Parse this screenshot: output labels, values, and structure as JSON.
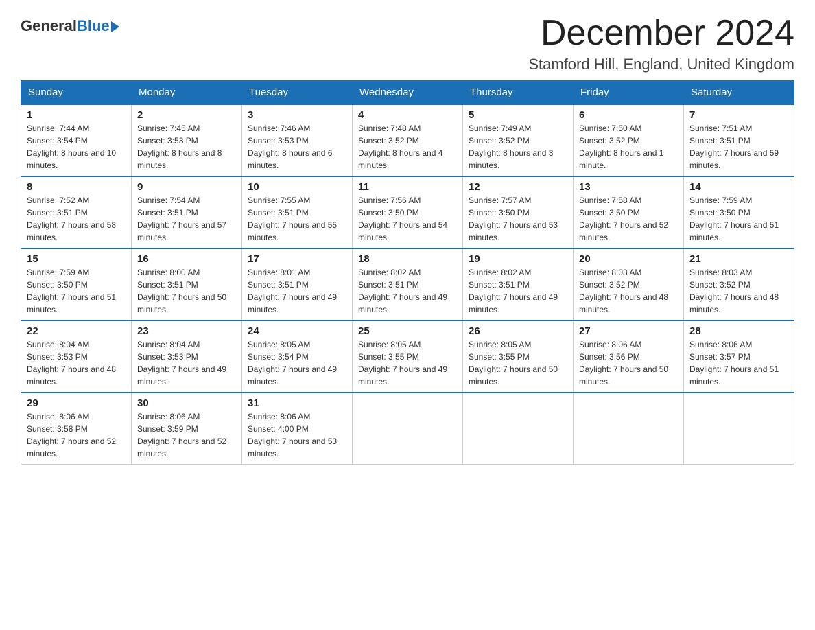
{
  "header": {
    "logo_general": "General",
    "logo_blue": "Blue",
    "month_title": "December 2024",
    "location": "Stamford Hill, England, United Kingdom"
  },
  "days_of_week": [
    "Sunday",
    "Monday",
    "Tuesday",
    "Wednesday",
    "Thursday",
    "Friday",
    "Saturday"
  ],
  "weeks": [
    [
      {
        "day": "1",
        "sunrise": "7:44 AM",
        "sunset": "3:54 PM",
        "daylight": "8 hours and 10 minutes."
      },
      {
        "day": "2",
        "sunrise": "7:45 AM",
        "sunset": "3:53 PM",
        "daylight": "8 hours and 8 minutes."
      },
      {
        "day": "3",
        "sunrise": "7:46 AM",
        "sunset": "3:53 PM",
        "daylight": "8 hours and 6 minutes."
      },
      {
        "day": "4",
        "sunrise": "7:48 AM",
        "sunset": "3:52 PM",
        "daylight": "8 hours and 4 minutes."
      },
      {
        "day": "5",
        "sunrise": "7:49 AM",
        "sunset": "3:52 PM",
        "daylight": "8 hours and 3 minutes."
      },
      {
        "day": "6",
        "sunrise": "7:50 AM",
        "sunset": "3:52 PM",
        "daylight": "8 hours and 1 minute."
      },
      {
        "day": "7",
        "sunrise": "7:51 AM",
        "sunset": "3:51 PM",
        "daylight": "7 hours and 59 minutes."
      }
    ],
    [
      {
        "day": "8",
        "sunrise": "7:52 AM",
        "sunset": "3:51 PM",
        "daylight": "7 hours and 58 minutes."
      },
      {
        "day": "9",
        "sunrise": "7:54 AM",
        "sunset": "3:51 PM",
        "daylight": "7 hours and 57 minutes."
      },
      {
        "day": "10",
        "sunrise": "7:55 AM",
        "sunset": "3:51 PM",
        "daylight": "7 hours and 55 minutes."
      },
      {
        "day": "11",
        "sunrise": "7:56 AM",
        "sunset": "3:50 PM",
        "daylight": "7 hours and 54 minutes."
      },
      {
        "day": "12",
        "sunrise": "7:57 AM",
        "sunset": "3:50 PM",
        "daylight": "7 hours and 53 minutes."
      },
      {
        "day": "13",
        "sunrise": "7:58 AM",
        "sunset": "3:50 PM",
        "daylight": "7 hours and 52 minutes."
      },
      {
        "day": "14",
        "sunrise": "7:59 AM",
        "sunset": "3:50 PM",
        "daylight": "7 hours and 51 minutes."
      }
    ],
    [
      {
        "day": "15",
        "sunrise": "7:59 AM",
        "sunset": "3:50 PM",
        "daylight": "7 hours and 51 minutes."
      },
      {
        "day": "16",
        "sunrise": "8:00 AM",
        "sunset": "3:51 PM",
        "daylight": "7 hours and 50 minutes."
      },
      {
        "day": "17",
        "sunrise": "8:01 AM",
        "sunset": "3:51 PM",
        "daylight": "7 hours and 49 minutes."
      },
      {
        "day": "18",
        "sunrise": "8:02 AM",
        "sunset": "3:51 PM",
        "daylight": "7 hours and 49 minutes."
      },
      {
        "day": "19",
        "sunrise": "8:02 AM",
        "sunset": "3:51 PM",
        "daylight": "7 hours and 49 minutes."
      },
      {
        "day": "20",
        "sunrise": "8:03 AM",
        "sunset": "3:52 PM",
        "daylight": "7 hours and 48 minutes."
      },
      {
        "day": "21",
        "sunrise": "8:03 AM",
        "sunset": "3:52 PM",
        "daylight": "7 hours and 48 minutes."
      }
    ],
    [
      {
        "day": "22",
        "sunrise": "8:04 AM",
        "sunset": "3:53 PM",
        "daylight": "7 hours and 48 minutes."
      },
      {
        "day": "23",
        "sunrise": "8:04 AM",
        "sunset": "3:53 PM",
        "daylight": "7 hours and 49 minutes."
      },
      {
        "day": "24",
        "sunrise": "8:05 AM",
        "sunset": "3:54 PM",
        "daylight": "7 hours and 49 minutes."
      },
      {
        "day": "25",
        "sunrise": "8:05 AM",
        "sunset": "3:55 PM",
        "daylight": "7 hours and 49 minutes."
      },
      {
        "day": "26",
        "sunrise": "8:05 AM",
        "sunset": "3:55 PM",
        "daylight": "7 hours and 50 minutes."
      },
      {
        "day": "27",
        "sunrise": "8:06 AM",
        "sunset": "3:56 PM",
        "daylight": "7 hours and 50 minutes."
      },
      {
        "day": "28",
        "sunrise": "8:06 AM",
        "sunset": "3:57 PM",
        "daylight": "7 hours and 51 minutes."
      }
    ],
    [
      {
        "day": "29",
        "sunrise": "8:06 AM",
        "sunset": "3:58 PM",
        "daylight": "7 hours and 52 minutes."
      },
      {
        "day": "30",
        "sunrise": "8:06 AM",
        "sunset": "3:59 PM",
        "daylight": "7 hours and 52 minutes."
      },
      {
        "day": "31",
        "sunrise": "8:06 AM",
        "sunset": "4:00 PM",
        "daylight": "7 hours and 53 minutes."
      },
      null,
      null,
      null,
      null
    ]
  ]
}
